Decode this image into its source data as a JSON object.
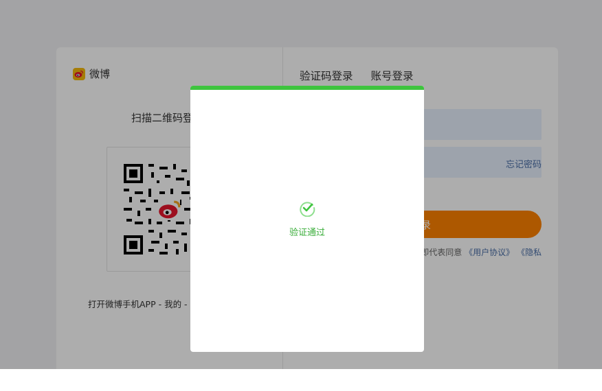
{
  "brand": {
    "name": "微博"
  },
  "qr": {
    "title": "扫描二维码登录",
    "hint": "打开微博手机APP - 我的 - 扫一扫"
  },
  "login": {
    "tabs": [
      "验证码登录",
      "账号登录"
    ],
    "forgot_password": "忘记密码",
    "submit_label": "登录",
    "agreement_prefix": "登录即代表同意",
    "user_agreement": "《用户协议》",
    "privacy": "《隐私"
  },
  "verify_modal": {
    "status_text": "验证通过",
    "accent_color": "#3ec43e"
  },
  "colors": {
    "login_button": "#ff8200",
    "link": "#4a6fa8"
  }
}
